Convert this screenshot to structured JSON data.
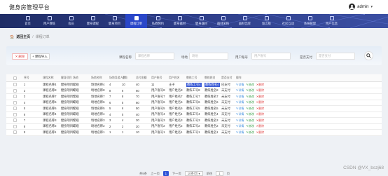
{
  "app": {
    "title": "健身房管理平台",
    "user": "admin"
  },
  "nav": {
    "items": [
      "首页",
      "用户教练",
      "会员",
      "健身课程",
      "健身项目",
      "课程订单",
      "私教预约",
      "健身器材",
      "健身器材",
      "器材采购",
      "器材出库",
      "留言板",
      "社区互动",
      "系统管理",
      "用户信息"
    ],
    "active_index": 5
  },
  "breadcrumb": {
    "home": "返回主页",
    "sep": "/",
    "current": "课程订单"
  },
  "toolbar": {
    "delete_label": "删除",
    "import_label": "课程导入",
    "filters": [
      {
        "label": "课程名称",
        "placeholder": "课程名称"
      },
      {
        "label": "场地",
        "placeholder": "场地"
      },
      {
        "label": "用户账号",
        "placeholder": "用户账号"
      },
      {
        "label": "是否支付",
        "placeholder": "是否支付"
      }
    ]
  },
  "table": {
    "columns": [
      "序号",
      "课程名称",
      "健身项目",
      "场地",
      "场地名称",
      "场地导游人数",
      "订购",
      "总付金额",
      "用户账号",
      "用户姓名",
      "教练工号",
      "教练姓名",
      "是否支付",
      "操作"
    ],
    "rows": [
      [
        "1",
        "课程名称4",
        "健身项目4",
        "常规",
        "场地名称4",
        "4",
        "10",
        "40",
        "11",
        "王子",
        "教练工号4",
        "教练姓名4",
        "已支付"
      ],
      [
        "2",
        "课程名称8",
        "健身项目8",
        "常规",
        "场地名称8",
        "8",
        "6",
        "60",
        "用户账号8",
        "用户姓名8",
        "教练工号8",
        "教练姓名8",
        "未支付"
      ],
      [
        "3",
        "课程名称7",
        "健身项目7",
        "常规",
        "场地名称7",
        "7",
        "8",
        "70",
        "用户账号7",
        "用户姓名7",
        "教练工号7",
        "教练姓名7",
        "未支付"
      ],
      [
        "4",
        "课程名称6",
        "健身项目6",
        "常规",
        "场地名称6",
        "6",
        "5",
        "60",
        "用户账号6",
        "用户姓名6",
        "教练工号6",
        "教练姓名6",
        "未支付"
      ],
      [
        "5",
        "课程名称5",
        "健身项目5",
        "常规",
        "场地名称5",
        "5",
        "6",
        "50",
        "用户账号5",
        "用户姓名5",
        "教练工号5",
        "教练姓名5",
        "未支付"
      ],
      [
        "6",
        "课程名称4",
        "健身项目4",
        "常规",
        "场地名称4",
        "4",
        "5",
        "40",
        "用户账号4",
        "用户姓名4",
        "教练工号4",
        "教练姓名4",
        "未支付"
      ],
      [
        "7",
        "课程名称3",
        "健身项目3",
        "常规",
        "场地名称3",
        "3",
        "4",
        "30",
        "用户账号3",
        "用户姓名3",
        "教练工号3",
        "教练姓名3",
        "未支付"
      ],
      [
        "8",
        "课程名称2",
        "健身项目2",
        "常规",
        "场地名称2",
        "2",
        "2",
        "20",
        "用户账号2",
        "用户姓名2",
        "教练工号2",
        "教练姓名2",
        "未支付"
      ],
      [
        "9",
        "课程名称1",
        "健身项目1",
        "常规",
        "场地名称1",
        "1",
        "1",
        "10",
        "用户账号1",
        "用户姓名1",
        "教练工号1",
        "教练姓名1",
        "未支付"
      ]
    ],
    "actions": {
      "detail": "详情",
      "edit": "修改",
      "delete": "删除"
    }
  },
  "pager": {
    "total": "共9条",
    "prev": "上一页",
    "page": "1",
    "next": "下一页",
    "size": "10条/页",
    "goto": "前往",
    "goto_value": "1",
    "page_unit": "页"
  },
  "watermark": "CSDN @VX_bszj68",
  "colors": {
    "nav_active": "#2a47c9",
    "primary": "#2f54d6",
    "danger": "#e24848"
  }
}
